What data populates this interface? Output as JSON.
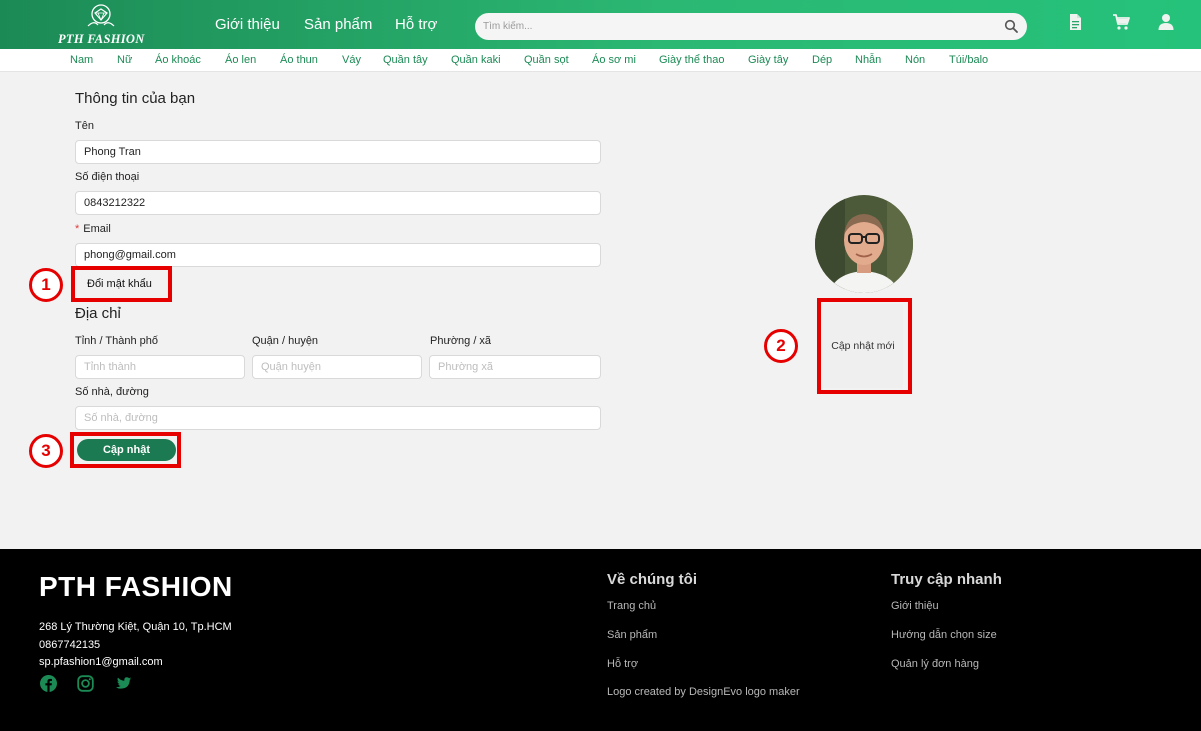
{
  "header": {
    "logo_text": "PTH FASHION",
    "nav": [
      "Giới thiệu",
      "Sản phẩm",
      "Hỗ trợ"
    ],
    "search_placeholder": "Tìm kiếm...",
    "icons": [
      "search-icon",
      "document-icon",
      "cart-icon",
      "user-icon"
    ]
  },
  "categories": [
    "Nam",
    "Nữ",
    "Áo khoác",
    "Áo len",
    "Áo thun",
    "Váy",
    "Quần tây",
    "Quần kaki",
    "Quần sọt",
    "Áo sơ mi",
    "Giày thể thao",
    "Giày tây",
    "Dép",
    "Nhẫn",
    "Nón",
    "Túi/balo"
  ],
  "profile": {
    "title": "Thông tin của bạn",
    "name_label": "Tên",
    "name_value": "Phong Tran",
    "phone_label": "Số điện thoại",
    "phone_value": "0843212322",
    "email_required_mark": "*",
    "email_label": "Email",
    "email_value": "phong@gmail.com",
    "change_password": "Đổi mật khẩu"
  },
  "address": {
    "title": "Địa chỉ",
    "province_label": "Tỉnh / Thành phố",
    "province_placeholder": "Tỉnh thành",
    "district_label": "Quận / huyện",
    "district_placeholder": "Quận huyện",
    "ward_label": "Phường / xã",
    "ward_placeholder": "Phường xã",
    "street_label": "Số nhà, đường",
    "street_placeholder": "Số nhà, đường"
  },
  "update_button": "Cập nhật",
  "avatar_update": "Cập nhật mới",
  "annotations": [
    "1",
    "2",
    "3"
  ],
  "footer": {
    "brand": "PTH FASHION",
    "address": "268 Lý Thường Kiệt, Quận 10, Tp.HCM",
    "phone": "0867742135",
    "email": "sp.pfashion1@gmail.com",
    "social_icons": [
      "facebook-icon",
      "instagram-icon",
      "twitter-icon"
    ],
    "about_title": "Về chúng tôi",
    "about_links": [
      "Trang chủ",
      "Sản phẩm",
      "Hỗ trợ",
      "Logo created by DesignEvo logo maker"
    ],
    "quick_title": "Truy cập nhanh",
    "quick_links": [
      "Giới thiệu",
      "Hướng dẫn chọn size",
      "Quản lý đơn hàng"
    ]
  },
  "colors": {
    "brand_green": "#1c8a55",
    "button_green": "#1c7a52",
    "annotation_red": "#e60000",
    "footer_bg": "#000000"
  }
}
